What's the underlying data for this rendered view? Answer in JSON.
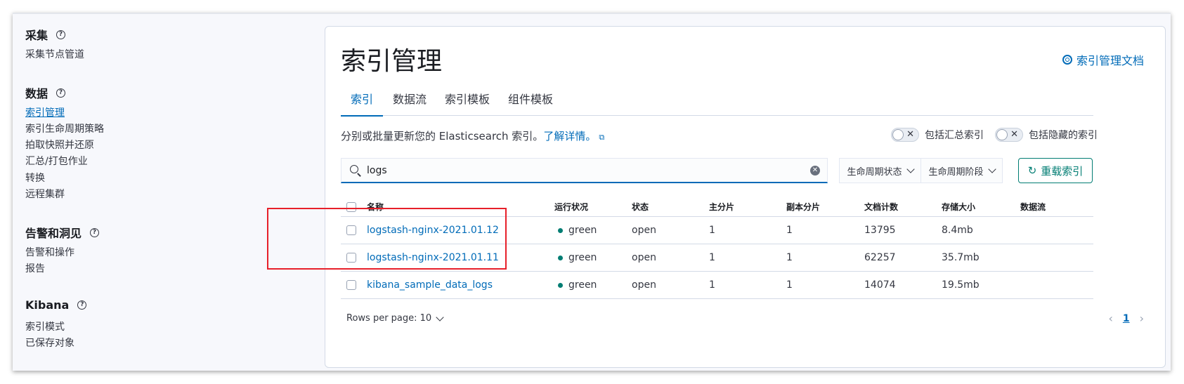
{
  "sidebar": {
    "sections": [
      {
        "title": "采集",
        "items": [
          "采集节点管道"
        ]
      },
      {
        "title": "数据",
        "items": [
          "索引管理",
          "索引生命周期策略",
          "拍取快照并还原",
          "汇总/打包作业",
          "转换",
          "远程集群"
        ]
      },
      {
        "title": "告警和洞见",
        "items": [
          "告警和操作",
          "报告"
        ]
      },
      {
        "title": "Kibana",
        "items": [
          "索引模式",
          "已保存对象"
        ]
      }
    ],
    "active_item": "索引管理"
  },
  "main": {
    "title": "索引管理",
    "doc_link": "索引管理文档",
    "tabs": [
      "索引",
      "数据流",
      "索引模板",
      "组件模板"
    ],
    "active_tab": "索引",
    "description": "分别或批量更新您的 Elasticsearch 索引。",
    "learn_more": "了解详情。",
    "toggles": [
      {
        "label": "包括汇总索引",
        "on": false
      },
      {
        "label": "包括隐藏的索引",
        "on": false
      }
    ],
    "search": {
      "value": "logs"
    },
    "filters": [
      "生命周期状态",
      "生命周期阶段"
    ],
    "reload_button": "重载索引",
    "table": {
      "columns": [
        "名称",
        "运行状况",
        "状态",
        "主分片",
        "副本分片",
        "文档计数",
        "存储大小",
        "数据流"
      ],
      "rows": [
        {
          "name": "logstash-nginx-2021.01.12",
          "health": "green",
          "status": "open",
          "primary": "1",
          "replicas": "1",
          "docs": "13795",
          "size": "8.4mb",
          "stream": ""
        },
        {
          "name": "logstash-nginx-2021.01.11",
          "health": "green",
          "status": "open",
          "primary": "1",
          "replicas": "1",
          "docs": "62257",
          "size": "35.7mb",
          "stream": ""
        },
        {
          "name": "kibana_sample_data_logs",
          "health": "green",
          "status": "open",
          "primary": "1",
          "replicas": "1",
          "docs": "14074",
          "size": "19.5mb",
          "stream": ""
        }
      ]
    },
    "rows_per_page": "Rows per page: 10",
    "current_page": "1"
  },
  "colors": {
    "accent": "#006bb8",
    "success": "#017d73",
    "highlight": "#e7202a"
  },
  "icons": [
    "help-icon",
    "lifebuoy-icon",
    "external-link-icon",
    "search-icon",
    "clear-icon",
    "chevron-down-icon",
    "refresh-icon",
    "status-dot-icon",
    "chevron-left-icon",
    "chevron-right-icon"
  ]
}
